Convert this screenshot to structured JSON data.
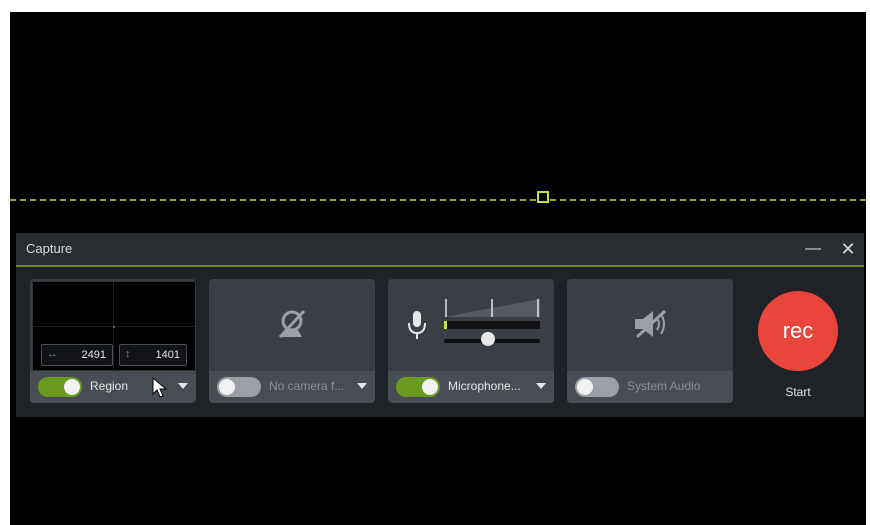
{
  "window": {
    "title": "Capture",
    "minimize_icon": "minimize-icon",
    "close_icon": "close-icon"
  },
  "region": {
    "width_value": "2491",
    "height_value": "1401",
    "label": "Region",
    "toggle_on": true,
    "width_arrow": "↔",
    "height_arrow": "↕"
  },
  "camera": {
    "label": "No camera f...",
    "toggle_on": false,
    "icon": "camera-off-icon"
  },
  "microphone": {
    "label": "Microphone...",
    "toggle_on": true,
    "icon": "microphone-icon",
    "volume_level": 0.45
  },
  "system_audio": {
    "label": "System Audio",
    "toggle_on": false,
    "icon": "speaker-muted-icon"
  },
  "record": {
    "button_label": "rec",
    "start_label": "Start"
  },
  "colors": {
    "accent_green": "#6a9a20",
    "guide_green": "#8ea832",
    "record_red": "#e8453c",
    "panel_bg": "#1f2226",
    "card_bg": "#3a3f45"
  }
}
